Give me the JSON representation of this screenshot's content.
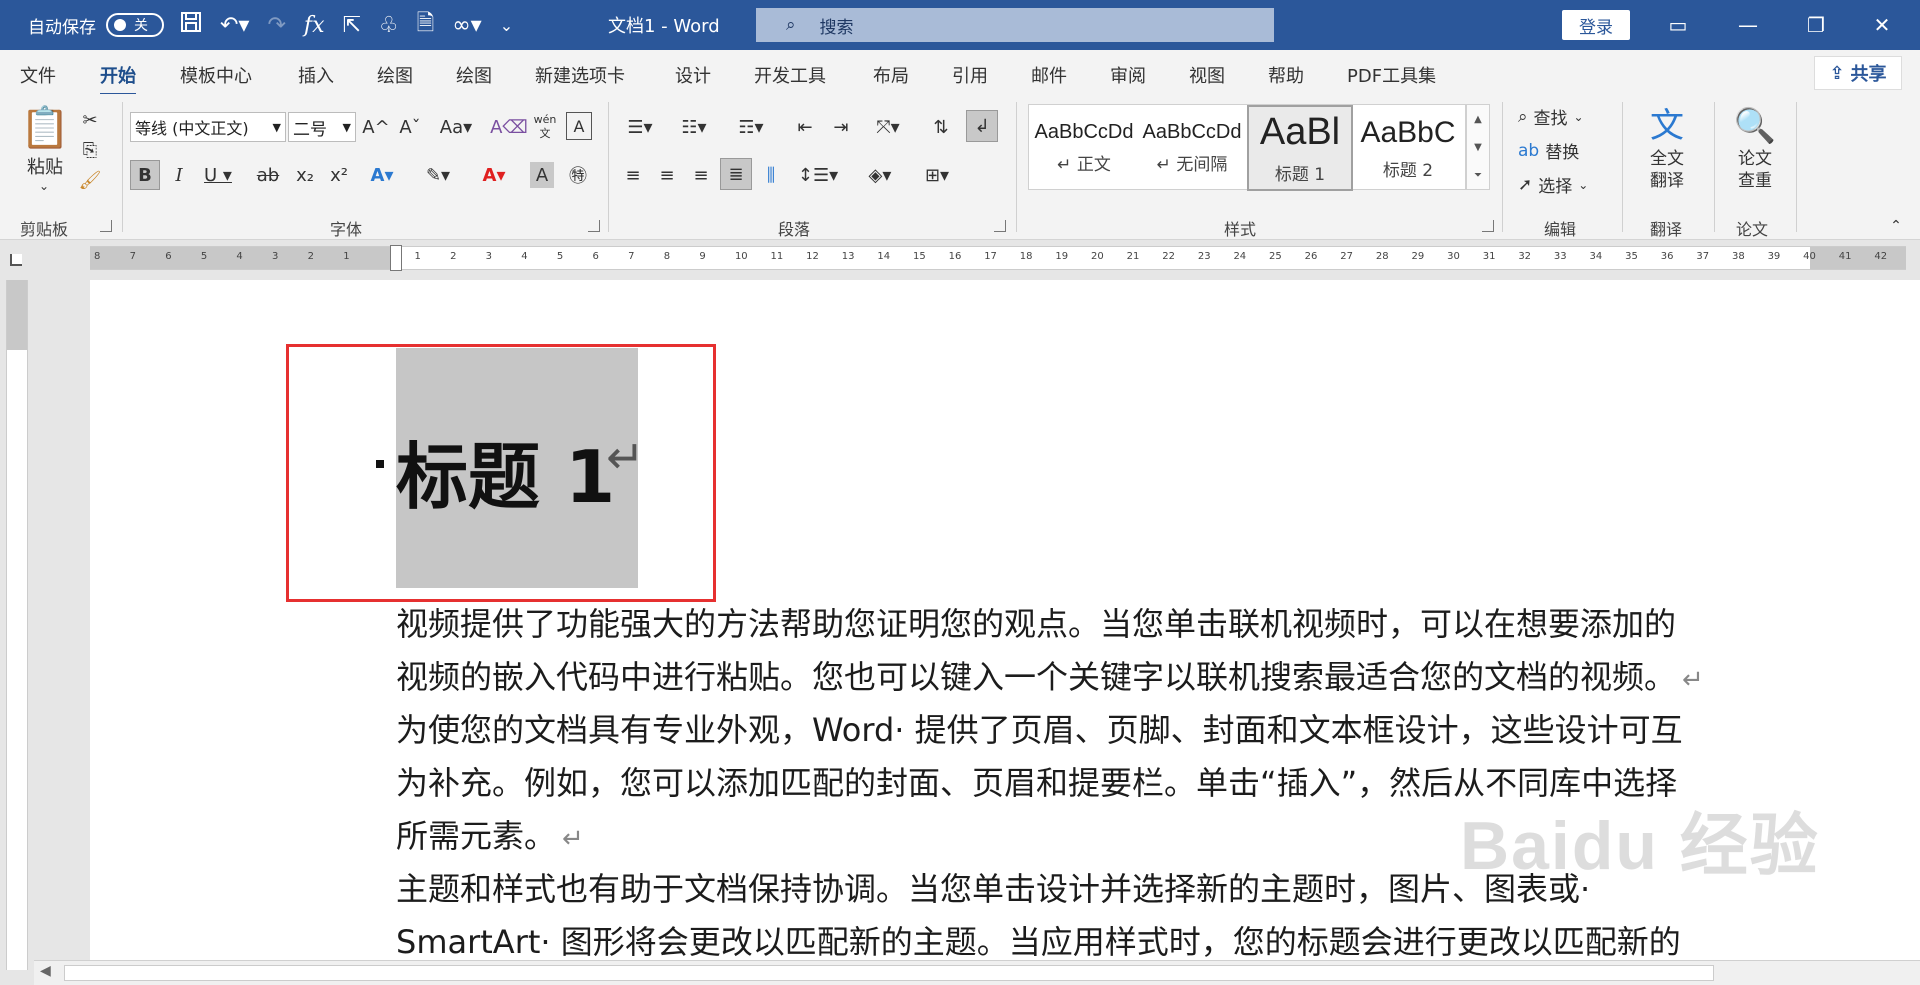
{
  "titlebar": {
    "autosave_label": "自动保存",
    "autosave_state": "关",
    "doc_title": "文档1 - Word",
    "search_placeholder": "搜索",
    "login": "登录"
  },
  "menu": {
    "items": [
      "文件",
      "开始",
      "模板中心",
      "插入",
      "绘图",
      "绘图",
      "新建选项卡",
      "设计",
      "开发工具",
      "布局",
      "引用",
      "邮件",
      "审阅",
      "视图",
      "帮助",
      "PDF工具集"
    ],
    "active": "开始",
    "share": "共享"
  },
  "ribbon": {
    "clipboard": {
      "paste": "粘贴",
      "label": "剪贴板"
    },
    "font": {
      "font_name": "等线 (中文正文)",
      "font_size": "二号",
      "label": "字体",
      "wen_top": "wén",
      "wen_bottom": "文"
    },
    "paragraph": {
      "label": "段落"
    },
    "styles": {
      "label": "样式",
      "items": [
        {
          "preview": "AaBbCcDd",
          "name": "↵ 正文"
        },
        {
          "preview": "AaBbCcDd",
          "name": "↵ 无间隔"
        },
        {
          "preview": "AaBl",
          "name": "标题 1"
        },
        {
          "preview": "AaBbC",
          "name": "标题 2"
        }
      ]
    },
    "editing": {
      "find": "查找",
      "replace": "替换",
      "select": "选择",
      "label": "编辑"
    },
    "translate": {
      "button": "全文翻译",
      "label": "翻译"
    },
    "thesis": {
      "button": "论文查重",
      "label": "论文"
    }
  },
  "ruler": {
    "ticks": [
      "8",
      "7",
      "6",
      "5",
      "4",
      "3",
      "2",
      "1",
      "",
      "1",
      "2",
      "3",
      "4",
      "5",
      "6",
      "7",
      "8",
      "9",
      "10",
      "11",
      "12",
      "13",
      "14",
      "15",
      "16",
      "17",
      "18",
      "19",
      "20",
      "21",
      "22",
      "23",
      "24",
      "25",
      "26",
      "27",
      "28",
      "29",
      "30",
      "31",
      "32",
      "33",
      "34",
      "35",
      "36",
      "37",
      "38",
      "39",
      "40",
      "41",
      "42"
    ]
  },
  "document": {
    "heading": "标题 1",
    "paragraphs": [
      {
        "lines": [
          "视频提供了功能强大的方法帮助您证明您的观点。当您单击联机视频时，可以在想要添加的",
          "视频的嵌入代码中进行粘贴。您也可以键入一个关键字以联机搜索最适合您的文档的视频。"
        ]
      },
      {
        "lines": [
          "为使您的文档具有专业外观，Word· 提供了页眉、页脚、封面和文本框设计，这些设计可互",
          "为补充。例如，您可以添加匹配的封面、页眉和提要栏。单击“插入”，然后从不同库中选择",
          "所需元素。"
        ]
      },
      {
        "lines": [
          "主题和样式也有助于文档保持协调。当您单击设计并选择新的主题时，图片、图表或·",
          "SmartArt· 图形将会更改以匹配新的主题。当应用样式时，您的标题会进行更改以匹配新的"
        ]
      }
    ],
    "watermark": "Baidu 经验"
  },
  "colors": {
    "titlebar": "#2b579a",
    "highlight": "#c6c6c6",
    "annotation": "#e63030"
  }
}
